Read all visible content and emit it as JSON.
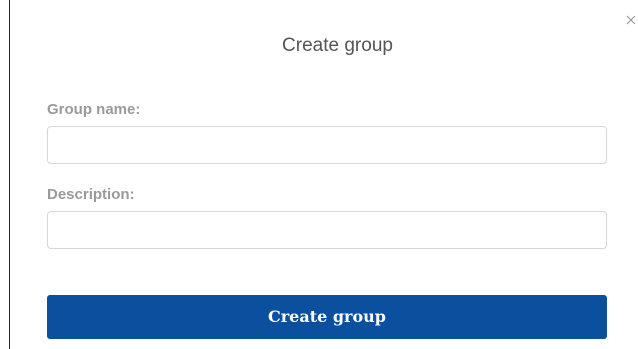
{
  "dialog": {
    "title": "Create group",
    "close_icon": "close-icon"
  },
  "form": {
    "group_name": {
      "label": "Group name:",
      "value": "",
      "placeholder": ""
    },
    "description": {
      "label": "Description:",
      "value": "",
      "placeholder": ""
    },
    "submit_label": "Create group"
  },
  "colors": {
    "primary_button": "#0b4f9f",
    "label_text": "#9a9a9a",
    "title_text": "#555555"
  }
}
